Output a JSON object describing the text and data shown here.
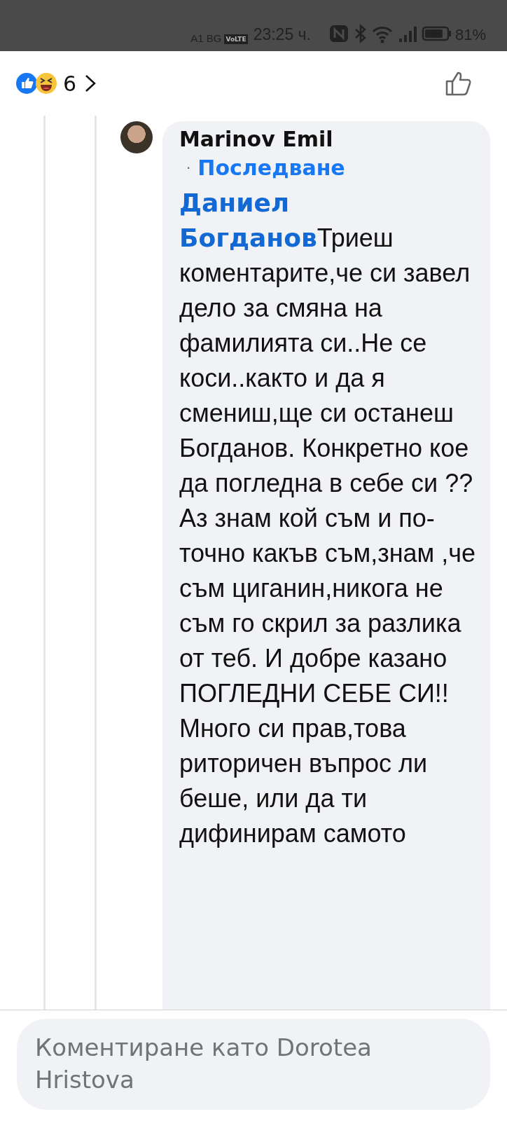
{
  "status_bar": {
    "carrier": "A1 BG",
    "network_badge": "VoLTE",
    "time": "23:25 ч.",
    "battery_percent": "81%"
  },
  "reactions": {
    "count": "6"
  },
  "comment": {
    "author": "Marinov Emil",
    "separator": "·",
    "follow_link": "Последване",
    "mention": "Даниел Богданов",
    "text": "Триеш коментарите,че си завел дело за смяна на фамилията си..Не се коси..както и да я смениш,ще си останеш Богданов. Конкретно кое да погледна в себе си ?? Аз знам кой съм и по-точно какъв съм,знам ,че съм циганин,никога не съм го скрил за разлика от теб. И добре казано ПОГЛЕДНИ СЕБЕ СИ!! Много си прав,това риторичен въпрос ли беше, или да ти дифинирам самото"
  },
  "comment_field": {
    "placeholder": "Коментиране като Dorotea Hristova"
  }
}
